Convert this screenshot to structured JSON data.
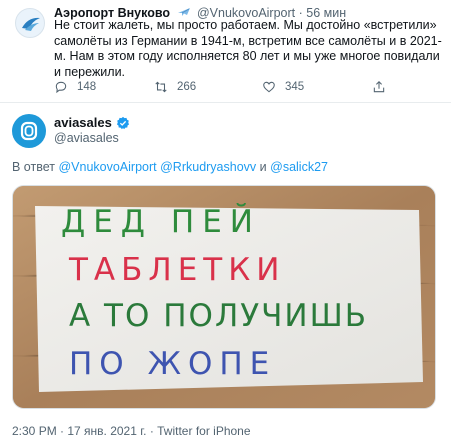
{
  "tweet1": {
    "author_name": "Аэропорт Внуково",
    "author_handle": "@VnukovoAirport",
    "separator": "·",
    "time": "56 мин",
    "text": "Не стоит жалеть, мы просто работаем. Мы достойно «встретили» самолёты из Германии в 1941-м, встретим все самолёты и в 2021-м. Нам в этом году исполняется 80 лет и мы уже многое повидали и пережили.",
    "actions": {
      "replies": "148",
      "retweets": "266",
      "likes": "345"
    }
  },
  "tweet2": {
    "author_name": "aviasales",
    "author_handle": "@aviasales",
    "reply_prefix": "В ответ",
    "reply_users": [
      "@VnukovoAirport",
      "@Rrkudryashovv",
      "@salick27"
    ],
    "reply_conjunction": "и",
    "image_text": {
      "line1": "ДЕД ПЕЙ",
      "line2": "ТАБЛЕТКИ",
      "line3": "А ТО ПОЛУЧИШЬ",
      "line4": "ПО ЖОПЕ"
    },
    "timestamp": "2:30 PM · 17 янв. 2021 г. · Twitter for iPhone"
  },
  "colors": {
    "accent": "#1d9bf0",
    "secondary_text": "#536471",
    "aviasales_brand": "#1e99d9"
  },
  "icons": [
    "airport-logo-icon",
    "airplane-emoji-icon",
    "reply-icon",
    "retweet-icon",
    "like-icon",
    "share-icon",
    "aviasales-logo-icon",
    "verified-badge-icon"
  ]
}
